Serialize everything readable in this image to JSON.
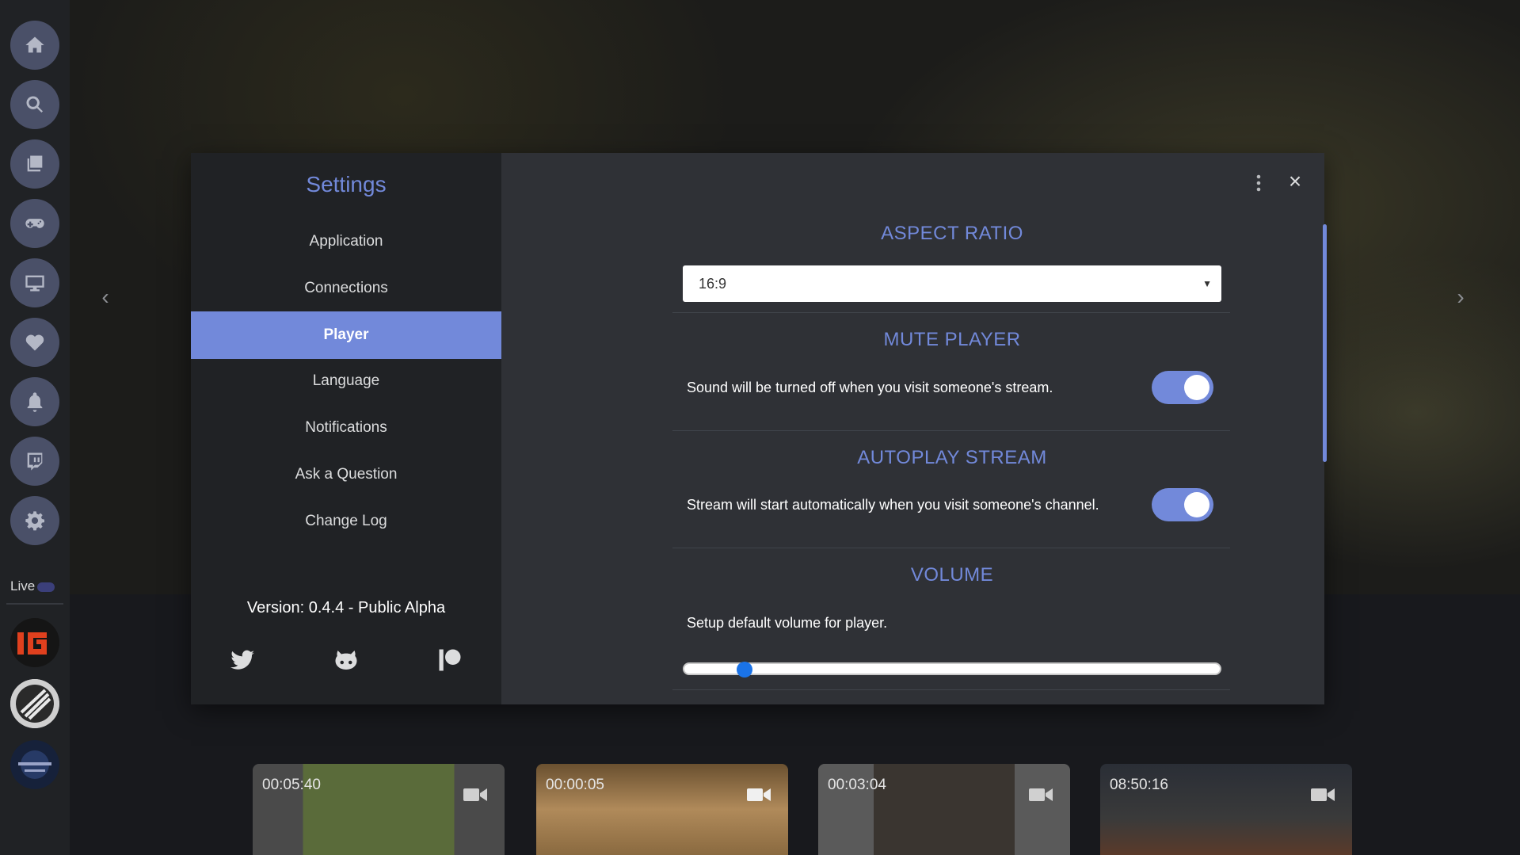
{
  "rail": {
    "buttons": [
      "home-icon",
      "search-icon",
      "library-icon",
      "gamepad-icon",
      "monitor-icon",
      "heart-icon",
      "bell-icon",
      "twitch-icon",
      "gear-icon"
    ],
    "live_label": "Live"
  },
  "thumbnails": [
    {
      "time": "00:05:40"
    },
    {
      "time": "00:00:05"
    },
    {
      "time": "00:03:04"
    },
    {
      "time": "08:50:16"
    }
  ],
  "settings": {
    "title": "Settings",
    "nav": [
      "Application",
      "Connections",
      "Player",
      "Language",
      "Notifications",
      "Ask a Question",
      "Change Log"
    ],
    "active_nav": "Player",
    "version": "Version: 0.4.4 - Public Alpha",
    "social": [
      "twitter-icon",
      "github-icon",
      "patreon-icon"
    ]
  },
  "player": {
    "aspect_ratio": {
      "title": "ASPECT RATIO",
      "value": "16:9"
    },
    "mute_player": {
      "title": "MUTE PLAYER",
      "description": "Sound will be turned off when you visit someone's stream.",
      "enabled": true
    },
    "autoplay": {
      "title": "AUTOPLAY STREAM",
      "description": "Stream will start automatically when you visit someone's channel.",
      "enabled": true
    },
    "volume": {
      "title": "VOLUME",
      "description": "Setup default volume for player.",
      "value": 0.1
    }
  },
  "colors": {
    "accent": "#7289da",
    "slider_thumb": "#1a73e8"
  }
}
